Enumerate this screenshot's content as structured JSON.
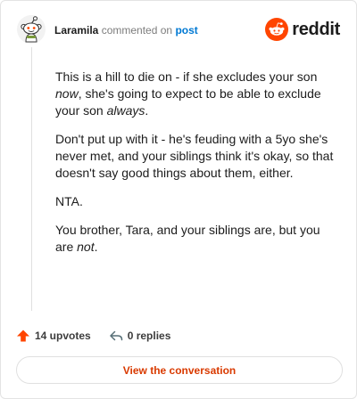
{
  "header": {
    "username": "Laramila",
    "action": "commented on",
    "link": "post",
    "brand": "reddit"
  },
  "comment": {
    "p1_a": "This is a hill to die on - if she excludes your son ",
    "p1_em1": "now",
    "p1_b": ", she's going to expect to be able to exclude your son ",
    "p1_em2": "always",
    "p1_c": ".",
    "p2": "Don't put up with it - he's feuding with a 5yo she's never met, and your siblings think it's okay, so that doesn't say good things about them, either.",
    "p3": "NTA.",
    "p4_a": "You brother, Tara, and your siblings are, but you are ",
    "p4_em": "not",
    "p4_b": "."
  },
  "footer": {
    "upvotes": "14 upvotes",
    "replies": "0 replies",
    "cta": "View the conversation"
  },
  "colors": {
    "brand": "#ff4500",
    "link": "#0079d3",
    "cta": "#d93a00"
  },
  "icons": {
    "avatar": "snoo-avatar-icon",
    "brand": "reddit-logo-icon",
    "upvote": "upvote-arrow-icon",
    "reply": "reply-arrow-icon"
  }
}
